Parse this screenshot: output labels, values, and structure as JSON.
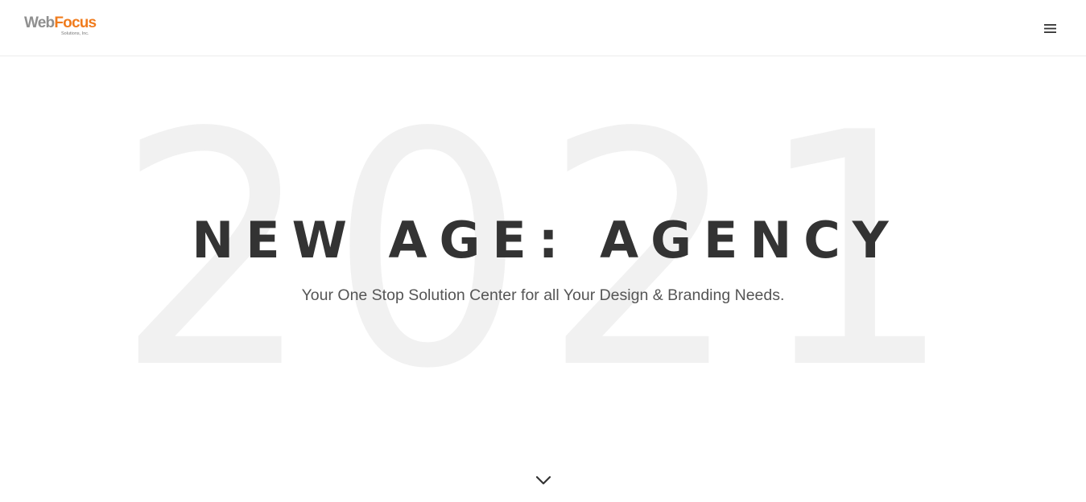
{
  "header": {
    "logo": {
      "primary_part1": "Web",
      "primary_part2": "Focus",
      "secondary": "Solutions, Inc.",
      "colors": {
        "web": "#8f8f8f",
        "focus": "#f07c1e"
      }
    },
    "menu_icon": "hamburger-menu-icon"
  },
  "hero": {
    "background_year": "2021",
    "title": "NEW AGE: AGENCY",
    "subtitle": "Your One Stop Solution Center for all Your Design & Branding Needs.",
    "scroll_icon": "chevron-down-icon"
  },
  "colors": {
    "title": "#333333",
    "subtitle": "#555555",
    "background_year": "#f1f1f1",
    "header_border": "#ececec"
  }
}
